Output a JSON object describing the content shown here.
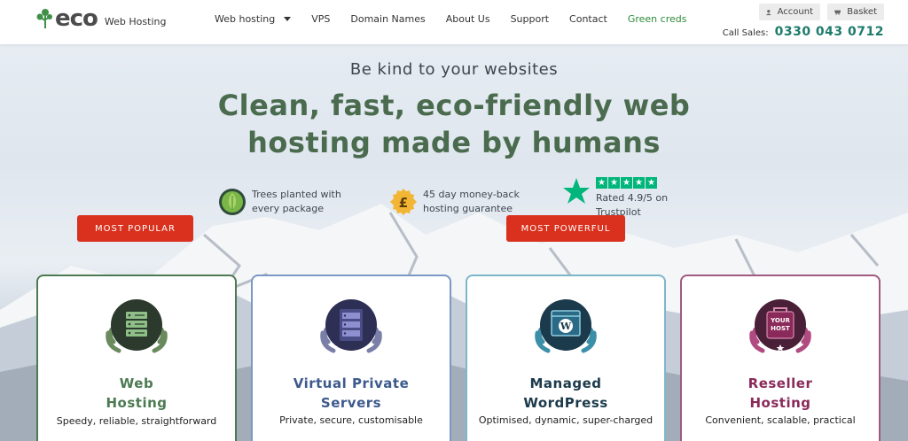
{
  "header": {
    "logo_word": "eco",
    "logo_sub": "Web Hosting",
    "nav": [
      {
        "label": "Web hosting"
      },
      {
        "label": "VPS"
      },
      {
        "label": "Domain Names"
      },
      {
        "label": "About Us"
      },
      {
        "label": "Support"
      },
      {
        "label": "Contact"
      },
      {
        "label": "Green creds"
      }
    ],
    "account_label": "Account",
    "basket_label": "Basket",
    "sales_label": "Call Sales:",
    "sales_phone": "0330 043 0712"
  },
  "hero": {
    "tagline": "Be kind to your websites",
    "headline": "Clean, fast, eco-friendly web hosting made by humans",
    "features": [
      {
        "line1": "Trees planted with",
        "line2": "every package",
        "icon": "tree-badge-icon"
      },
      {
        "line1": "45 day money-back",
        "line2": "hosting guarantee",
        "icon": "pound-badge-icon"
      },
      {
        "line1": "Rated 4.9/5 on",
        "line2": "Trustpilot",
        "icon": "trustpilot-star-icon"
      }
    ]
  },
  "cards": [
    {
      "ribbon": "MOST POPULAR",
      "title1": "Web",
      "title2": "Hosting",
      "sub": "Speedy, reliable, straightforward",
      "color": "#4c7a52",
      "icon": "server-stack-icon"
    },
    {
      "ribbon": "",
      "title1": "Virtual Private",
      "title2": "Servers",
      "sub": "Private, secure, customisable",
      "color": "#3d5a8c",
      "icon": "vps-server-icon"
    },
    {
      "ribbon": "MOST POWERFUL",
      "title1": "Managed",
      "title2": "WordPress",
      "sub": "Optimised, dynamic, super-charged",
      "color": "#1b3a4b",
      "icon": "wordpress-browser-icon"
    },
    {
      "ribbon": "",
      "title1": "Reseller",
      "title2": "Hosting",
      "sub": "Convenient, scalable, practical",
      "color": "#8a2a5a",
      "icon": "your-host-bag-icon",
      "icon_text1": "YOUR",
      "icon_text2": "HOST"
    }
  ]
}
